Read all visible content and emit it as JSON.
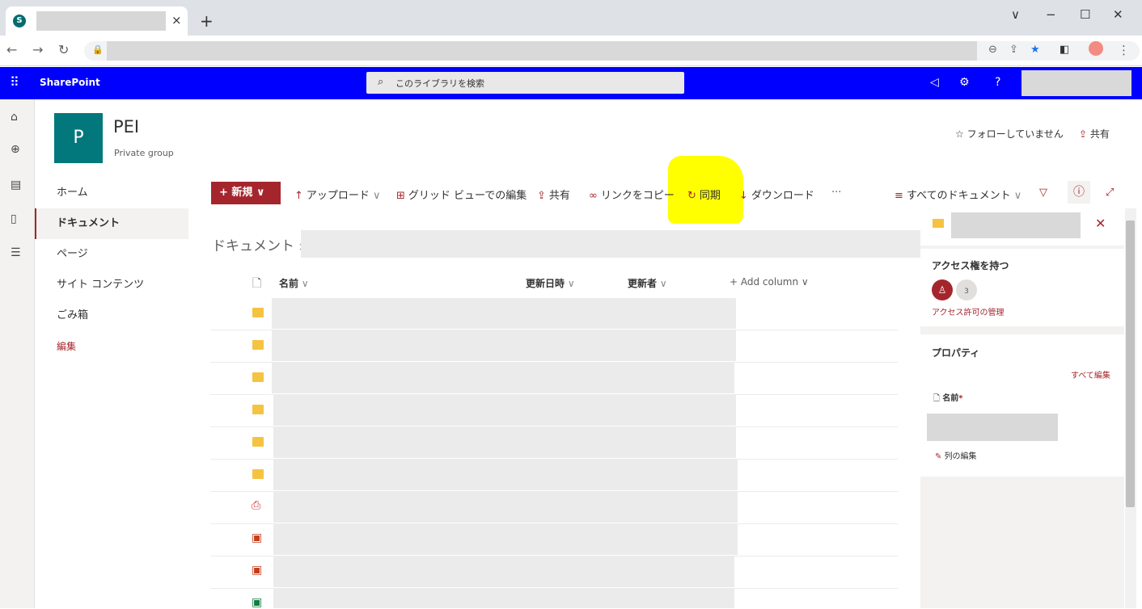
{
  "browser": {
    "tab_close": "×",
    "new_tab": "+",
    "favicon_letter": "S"
  },
  "suitebar": {
    "app_name": "SharePoint",
    "search_placeholder": "このライブラリを検索",
    "help": "?"
  },
  "site": {
    "logo_letter": "P",
    "title": "PEI",
    "subtitle": "Private group",
    "follow": "☆ フォローしていません",
    "share": "共有"
  },
  "leftnav": {
    "items": [
      "ホーム",
      "ドキュメント",
      "ページ",
      "サイト コンテンツ",
      "ごみ箱",
      "編集"
    ],
    "active_index": 1
  },
  "commandbar": {
    "new": "新規",
    "upload": "アップロード",
    "grid_edit": "グリッド ビューでの編集",
    "share": "共有",
    "copy_link": "リンクをコピー",
    "sync": "同期",
    "download": "ダウンロード",
    "more": "···",
    "view": "すべてのドキュメント"
  },
  "breadcrumb": {
    "root": "ドキュメント",
    "separator": ">"
  },
  "list": {
    "columns": {
      "name": "名前",
      "modified": "更新日時",
      "modified_by": "更新者",
      "add_column": "+ Add column"
    },
    "rows": [
      {
        "type": "folder"
      },
      {
        "type": "folder"
      },
      {
        "type": "folder"
      },
      {
        "type": "folder"
      },
      {
        "type": "folder"
      },
      {
        "type": "folder"
      },
      {
        "type": "pdf"
      },
      {
        "type": "pptx"
      },
      {
        "type": "pptx"
      },
      {
        "type": "xlsx"
      }
    ]
  },
  "details_pane": {
    "access_heading": "アクセス権を持つ",
    "member_count": "3",
    "manage_access": "アクセス許可の管理",
    "properties_heading": "プロパティ",
    "edit_all": "すべて編集",
    "name_label": "名前",
    "required_mark": "*",
    "edit_columns": "列の編集"
  },
  "colors": {
    "suitebar": "#0000ff",
    "accent": "#a4262c",
    "site_logo": "#03787c",
    "highlight": "#ffff00",
    "folder": "#f5c342"
  }
}
